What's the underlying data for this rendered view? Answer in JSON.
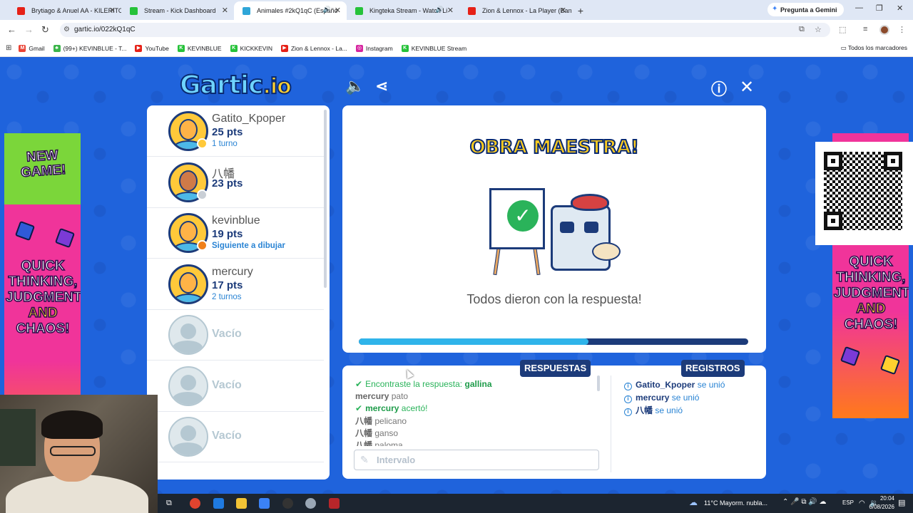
{
  "browser": {
    "tabs": [
      {
        "title": "Brytiago & Anuel AA - KILERITO",
        "favicon": "youtube-icon",
        "color": "#e62117",
        "active": false,
        "sound": false
      },
      {
        "title": "Stream - Kick Dashboard",
        "favicon": "kick-icon",
        "color": "#26c23a",
        "active": false,
        "sound": false
      },
      {
        "title": "Animales #2kQ1qC (Españo",
        "favicon": "gartic-icon",
        "color": "#2fa6d8",
        "active": true,
        "sound": true
      },
      {
        "title": "Kingteka Stream - Watch Li",
        "favicon": "kick-icon",
        "color": "#26c23a",
        "active": false,
        "sound": true
      },
      {
        "title": "Zion & Lennox - La Player (Ban",
        "favicon": "youtube-icon",
        "color": "#e62117",
        "active": false,
        "sound": false
      }
    ],
    "gemini_label": "Pregunta a Gemini",
    "url": "gartic.io/022kQ1qC",
    "bookmarks": [
      {
        "label": "Gmail",
        "color": "#ea4335",
        "glyph": "M"
      },
      {
        "label": "(99+) KEVINBLUE - T...",
        "color": "#3bb54a",
        "glyph": "♣"
      },
      {
        "label": "YouTube",
        "color": "#e62117",
        "glyph": "▶"
      },
      {
        "label": "KEVINBLUE",
        "color": "#26c23a",
        "glyph": "K"
      },
      {
        "label": "KICKKEVIN",
        "color": "#26c23a",
        "glyph": "K"
      },
      {
        "label": "Zion & Lennox - La...",
        "color": "#e62117",
        "glyph": "▶"
      },
      {
        "label": "Instagram",
        "color": "#d6249f",
        "glyph": "◎"
      },
      {
        "label": "KEVINBLUE Stream",
        "color": "#26c23a",
        "glyph": "K"
      }
    ],
    "all_bookmarks": "Todos los marcadores"
  },
  "ads": {
    "new_game": "NEW GAME!",
    "quick": "QUICK THINKING, JUDGMENT",
    "and": "AND",
    "chaos": "CHAOS!"
  },
  "players": [
    {
      "name": "Gatito_Kpoper",
      "points": "25 pts",
      "turn": "1 turno",
      "status_color": "#ffc93a",
      "dark": false
    },
    {
      "name": "八幡",
      "points": "23 pts",
      "turn": "",
      "status_color": "#c9cfd6",
      "dark": true
    },
    {
      "name": "kevinblue",
      "points": "19 pts",
      "turn": "Siguiente a dibujar",
      "status_color": "#f0801a",
      "dark": false
    },
    {
      "name": "mercury",
      "points": "17 pts",
      "turn": "2 turnos",
      "status_color": "",
      "dark": false
    },
    {
      "name": "Vacío",
      "empty": true
    },
    {
      "name": "Vacío",
      "empty": true
    },
    {
      "name": "Vacío",
      "empty": true
    }
  ],
  "round": {
    "title": "OBRA MAESTRA!",
    "message": "Todos dieron con la respuesta!",
    "progress": 0.59
  },
  "chat": {
    "answers_label": "RESPUESTAS",
    "logs_label": "REGISTROS",
    "answers": [
      {
        "type": "found",
        "text": "Encontraste la respuesta: ",
        "highlight": "gallina"
      },
      {
        "type": "guess",
        "who": "mercury",
        "text": "pato"
      },
      {
        "type": "correct",
        "who": "mercury",
        "text": "acertó!"
      },
      {
        "type": "guess",
        "who": "八幡",
        "text": "pelicano"
      },
      {
        "type": "guess",
        "who": "八幡",
        "text": "ganso"
      },
      {
        "type": "guess",
        "who": "八幡",
        "text": "paloma"
      }
    ],
    "input_placeholder": "Intervalo",
    "logs": [
      {
        "who": "Gatito_Kpoper",
        "text": "se unió"
      },
      {
        "who": "mercury",
        "text": "se unió"
      },
      {
        "who": "八幡",
        "text": "se unió"
      }
    ]
  },
  "taskbar": {
    "weather": "11°C  Mayorm. nubla...",
    "lang": "ESP",
    "time": "20:04",
    "date": "6/08/2026"
  }
}
